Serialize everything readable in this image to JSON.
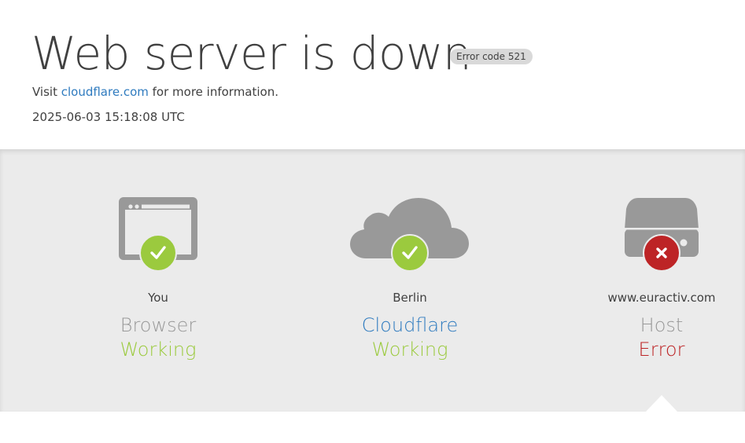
{
  "header": {
    "title": "Web server is down",
    "error_badge": "Error code 521",
    "visit_prefix": "Visit ",
    "visit_link": "cloudflare.com",
    "visit_suffix": " for more information.",
    "timestamp": "2025-06-03 15:18:08 UTC"
  },
  "status": [
    {
      "place": "You",
      "role": "Browser",
      "state": "Working",
      "icon": "browser-icon",
      "indicator": "check-icon"
    },
    {
      "place": "Berlin",
      "role": "Cloudflare",
      "state": "Working",
      "icon": "cloud-icon",
      "indicator": "check-icon"
    },
    {
      "place": "www.euractiv.com",
      "role": "Host",
      "state": "Error",
      "icon": "server-icon",
      "indicator": "x-icon"
    }
  ],
  "colors": {
    "ok": "#9bca3e",
    "error": "#bd2426",
    "link": "#2f7bbf",
    "icon_gray": "#999999",
    "band_bg": "#ebebeb"
  }
}
